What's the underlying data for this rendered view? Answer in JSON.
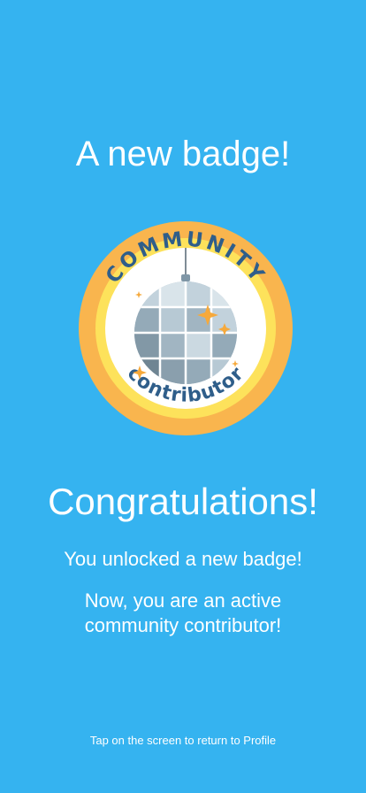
{
  "screen": {
    "heading": "A new badge!",
    "badge": {
      "top_text": "COMMUNITY",
      "bottom_text": "contributor",
      "icon": "disco-ball-icon",
      "colors": {
        "outer_ring": "#f9b54e",
        "inner_ring": "#fde25b",
        "center": "#ffffff",
        "text": "#2f5e8a",
        "sparkle": "#f6a93b"
      }
    },
    "congrats_title": "Congratulations!",
    "message_line1": "You unlocked a new badge!",
    "message_line2": "Now, you are an active community contributor!",
    "footer_hint": "Tap on the screen to return to Profile"
  },
  "colors": {
    "background": "#35b3f0",
    "text": "#ffffff"
  }
}
